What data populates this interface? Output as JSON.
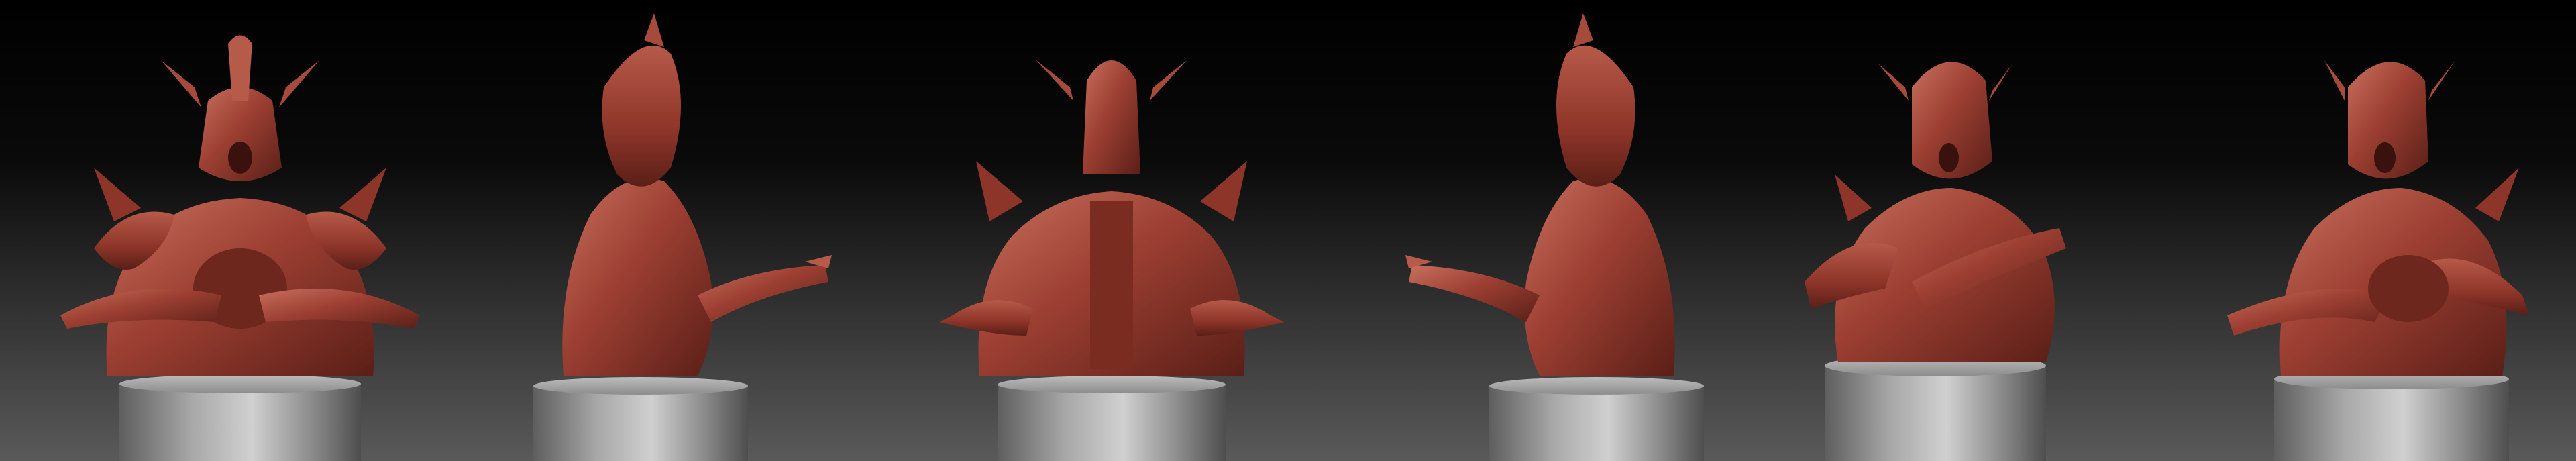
{
  "scene": {
    "background_top": "#000000",
    "background_bottom": "#5a5a5a",
    "clay_color": "#9c3f32",
    "clay_highlight": "#c8705e",
    "clay_shadow": "#5a1f17",
    "pedestal_color": "#9a9a9a",
    "pedestal_highlight": "#d0d0d0",
    "pedestal_shadow": "#5e5e5e"
  },
  "views": [
    {
      "id": "front",
      "label": ""
    },
    {
      "id": "left-profile",
      "label": ""
    },
    {
      "id": "back",
      "label": ""
    },
    {
      "id": "right-profile",
      "label": ""
    },
    {
      "id": "three-quarter-left",
      "label": ""
    },
    {
      "id": "three-quarter-right",
      "label": ""
    }
  ]
}
